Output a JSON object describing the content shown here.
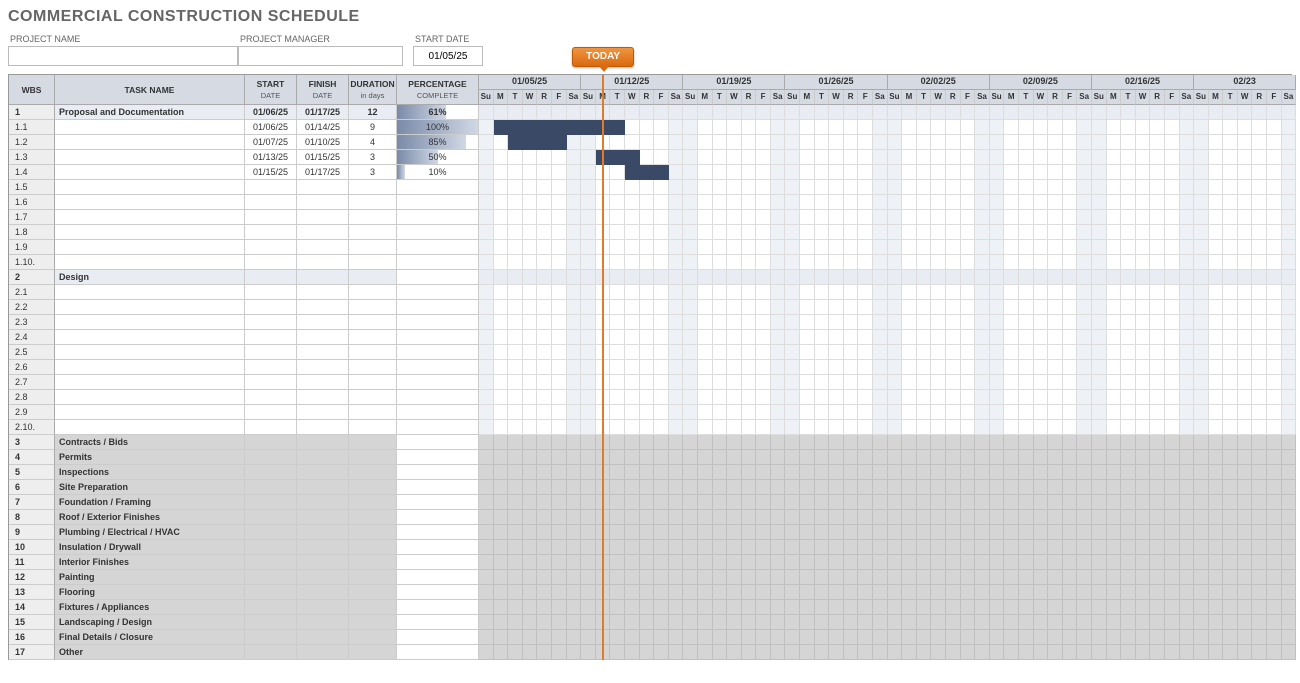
{
  "title": "COMMERCIAL CONSTRUCTION SCHEDULE",
  "meta": {
    "project_name_label": "PROJECT NAME",
    "project_name_value": "",
    "project_manager_label": "PROJECT MANAGER",
    "project_manager_value": "",
    "start_date_label": "START DATE",
    "start_date_value": "01/05/25"
  },
  "today_label": "TODAY",
  "headers": {
    "wbs": "WBS",
    "task": "TASK NAME",
    "start": "START",
    "start_sub": "DATE",
    "finish": "FINISH",
    "finish_sub": "DATE",
    "duration": "DURATION",
    "duration_sub": "in days",
    "pct": "PERCENTAGE",
    "pct_sub": "COMPLETE"
  },
  "weeks": [
    "01/05/25",
    "01/12/25",
    "01/19/25",
    "01/26/25",
    "02/02/25",
    "02/09/25",
    "02/16/25",
    "02/23"
  ],
  "day_labels": [
    "Su",
    "M",
    "T",
    "W",
    "R",
    "F",
    "Sa"
  ],
  "rows": [
    {
      "wbs": "1",
      "task": "Proposal and Documentation",
      "start": "01/06/25",
      "finish": "01/17/25",
      "dur": "12",
      "pct": 61,
      "type": "section-light"
    },
    {
      "wbs": "1.1",
      "task": "",
      "start": "01/06/25",
      "finish": "01/14/25",
      "dur": "9",
      "pct": 100,
      "type": "data",
      "bar_start": 1,
      "bar_len": 9
    },
    {
      "wbs": "1.2",
      "task": "",
      "start": "01/07/25",
      "finish": "01/10/25",
      "dur": "4",
      "pct": 85,
      "type": "data",
      "bar_start": 2,
      "bar_len": 4
    },
    {
      "wbs": "1.3",
      "task": "",
      "start": "01/13/25",
      "finish": "01/15/25",
      "dur": "3",
      "pct": 50,
      "type": "data",
      "bar_start": 8,
      "bar_len": 3
    },
    {
      "wbs": "1.4",
      "task": "",
      "start": "01/15/25",
      "finish": "01/17/25",
      "dur": "3",
      "pct": 10,
      "type": "data",
      "bar_start": 10,
      "bar_len": 3
    },
    {
      "wbs": "1.5",
      "task": "",
      "type": "empty"
    },
    {
      "wbs": "1.6",
      "task": "",
      "type": "empty"
    },
    {
      "wbs": "1.7",
      "task": "",
      "type": "empty"
    },
    {
      "wbs": "1.8",
      "task": "",
      "type": "empty"
    },
    {
      "wbs": "1.9",
      "task": "",
      "type": "empty"
    },
    {
      "wbs": "1.10.",
      "task": "",
      "type": "empty"
    },
    {
      "wbs": "2",
      "task": "Design",
      "type": "section-light"
    },
    {
      "wbs": "2.1",
      "task": "",
      "type": "empty"
    },
    {
      "wbs": "2.2",
      "task": "",
      "type": "empty"
    },
    {
      "wbs": "2.3",
      "task": "",
      "type": "empty"
    },
    {
      "wbs": "2.4",
      "task": "",
      "type": "empty"
    },
    {
      "wbs": "2.5",
      "task": "",
      "type": "empty"
    },
    {
      "wbs": "2.6",
      "task": "",
      "type": "empty"
    },
    {
      "wbs": "2.7",
      "task": "",
      "type": "empty"
    },
    {
      "wbs": "2.8",
      "task": "",
      "type": "empty"
    },
    {
      "wbs": "2.9",
      "task": "",
      "type": "empty"
    },
    {
      "wbs": "2.10.",
      "task": "",
      "type": "empty"
    },
    {
      "wbs": "3",
      "task": "Contracts / Bids",
      "type": "section"
    },
    {
      "wbs": "4",
      "task": "Permits",
      "type": "section"
    },
    {
      "wbs": "5",
      "task": "Inspections",
      "type": "section"
    },
    {
      "wbs": "6",
      "task": "Site Preparation",
      "type": "section"
    },
    {
      "wbs": "7",
      "task": "Foundation / Framing",
      "type": "section"
    },
    {
      "wbs": "8",
      "task": "Roof / Exterior Finishes",
      "type": "section"
    },
    {
      "wbs": "9",
      "task": "Plumbing / Electrical / HVAC",
      "type": "section"
    },
    {
      "wbs": "10",
      "task": "Insulation / Drywall",
      "type": "section"
    },
    {
      "wbs": "11",
      "task": "Interior Finishes",
      "type": "section"
    },
    {
      "wbs": "12",
      "task": "Painting",
      "type": "section"
    },
    {
      "wbs": "13",
      "task": "Flooring",
      "type": "section"
    },
    {
      "wbs": "14",
      "task": "Fixtures / Appliances",
      "type": "section"
    },
    {
      "wbs": "15",
      "task": "Landscaping / Design",
      "type": "section"
    },
    {
      "wbs": "16",
      "task": "Final Details / Closure",
      "type": "section"
    },
    {
      "wbs": "17",
      "task": "Other",
      "type": "section"
    }
  ],
  "chart_data": {
    "type": "gantt",
    "title": "Commercial Construction Schedule",
    "start_date": "2025-01-05",
    "today": "2025-01-13",
    "time_unit": "days",
    "weeks": [
      "2025-01-05",
      "2025-01-12",
      "2025-01-19",
      "2025-01-26",
      "2025-02-02",
      "2025-02-09",
      "2025-02-16",
      "2025-02-23"
    ],
    "tasks": [
      {
        "id": "1",
        "name": "Proposal and Documentation",
        "start": "2025-01-06",
        "finish": "2025-01-17",
        "duration_days": 12,
        "percent_complete": 61,
        "is_summary": true
      },
      {
        "id": "1.1",
        "name": "",
        "start": "2025-01-06",
        "finish": "2025-01-14",
        "duration_days": 9,
        "percent_complete": 100
      },
      {
        "id": "1.2",
        "name": "",
        "start": "2025-01-07",
        "finish": "2025-01-10",
        "duration_days": 4,
        "percent_complete": 85
      },
      {
        "id": "1.3",
        "name": "",
        "start": "2025-01-13",
        "finish": "2025-01-15",
        "duration_days": 3,
        "percent_complete": 50
      },
      {
        "id": "1.4",
        "name": "",
        "start": "2025-01-15",
        "finish": "2025-01-17",
        "duration_days": 3,
        "percent_complete": 10
      },
      {
        "id": "2",
        "name": "Design",
        "is_summary": true
      },
      {
        "id": "3",
        "name": "Contracts / Bids",
        "is_summary": true
      },
      {
        "id": "4",
        "name": "Permits",
        "is_summary": true
      },
      {
        "id": "5",
        "name": "Inspections",
        "is_summary": true
      },
      {
        "id": "6",
        "name": "Site Preparation",
        "is_summary": true
      },
      {
        "id": "7",
        "name": "Foundation / Framing",
        "is_summary": true
      },
      {
        "id": "8",
        "name": "Roof / Exterior Finishes",
        "is_summary": true
      },
      {
        "id": "9",
        "name": "Plumbing / Electrical / HVAC",
        "is_summary": true
      },
      {
        "id": "10",
        "name": "Insulation / Drywall",
        "is_summary": true
      },
      {
        "id": "11",
        "name": "Interior Finishes",
        "is_summary": true
      },
      {
        "id": "12",
        "name": "Painting",
        "is_summary": true
      },
      {
        "id": "13",
        "name": "Flooring",
        "is_summary": true
      },
      {
        "id": "14",
        "name": "Fixtures / Appliances",
        "is_summary": true
      },
      {
        "id": "15",
        "name": "Landscaping / Design",
        "is_summary": true
      },
      {
        "id": "16",
        "name": "Final Details / Closure",
        "is_summary": true
      },
      {
        "id": "17",
        "name": "Other",
        "is_summary": true
      }
    ]
  }
}
